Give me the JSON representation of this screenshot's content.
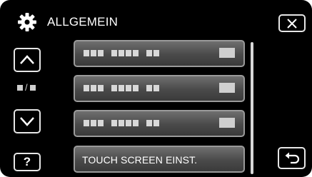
{
  "header": {
    "title": "ALLGEMEIN",
    "icon": "gear-icon",
    "close_icon": "close-icon"
  },
  "nav": {
    "up_icon": "chevron-up-icon",
    "down_icon": "chevron-down-icon",
    "page_indicator_separator": "/",
    "help_label": "?",
    "back_icon": "return-icon"
  },
  "menu": {
    "items": [
      {
        "label": "",
        "placeholder": true
      },
      {
        "label": "",
        "placeholder": true
      },
      {
        "label": "",
        "placeholder": true
      },
      {
        "label": "TOUCH SCREEN EINST.",
        "placeholder": false
      }
    ]
  },
  "colors": {
    "background": "#000000",
    "text": "#ffffff",
    "button_border": "#e6e6e6",
    "item_border": "#9a9a9a"
  }
}
